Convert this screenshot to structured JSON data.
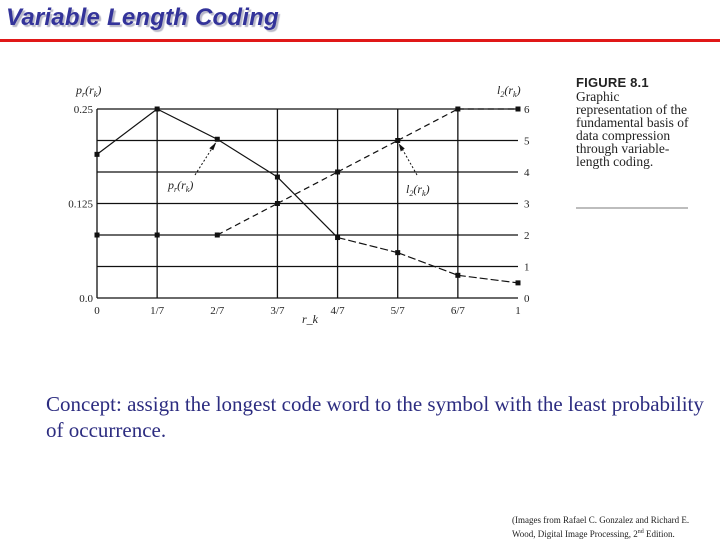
{
  "slide": {
    "title": "Variable Length Coding",
    "accent_color": "#e01818",
    "title_color": "#33339a",
    "concept_text": "Concept: assign the longest code word to the symbol with the least probability of occurrence.",
    "credit_line1": "(Images from Rafael C. Gonzalez and Richard E.",
    "credit_line2_pre": "Wood, Digital Image Processing, 2",
    "credit_sup": "nd",
    "credit_line2_post": " Edition."
  },
  "figure": {
    "label": "FIGURE 8.1",
    "caption": "Graphic representation of the fundamental basis of data compression through variable-length coding."
  },
  "chart_data": {
    "type": "line",
    "title": "",
    "xlabel": "r_k",
    "x": [
      0,
      0.142857,
      0.285714,
      0.428571,
      0.571429,
      0.714286,
      0.857143,
      1
    ],
    "x_tick_labels": [
      "0",
      "1/7",
      "2/7",
      "3/7",
      "4/7",
      "5/7",
      "6/7",
      "1"
    ],
    "left_axis": {
      "label": "p_r(r_k)",
      "ylim": [
        0,
        0.25
      ],
      "tick_values": [
        0,
        0.125,
        0.25
      ],
      "tick_labels": [
        "0.0",
        "0.125",
        "0.25"
      ]
    },
    "right_axis": {
      "label": "l_2(r_k)",
      "ylim": [
        0,
        6
      ],
      "tick_values": [
        0,
        1,
        2,
        3,
        4,
        5,
        6
      ],
      "tick_labels": [
        "0",
        "1",
        "2",
        "3",
        "4",
        "5",
        "6"
      ]
    },
    "grid": true,
    "vertical_gridlines_at": [
      0,
      1,
      3,
      4,
      5,
      6
    ],
    "series": [
      {
        "name": "p_r(r_k)",
        "axis": "left",
        "style": "solid",
        "values": [
          0.19,
          0.25,
          0.21,
          0.16,
          0.08,
          0.06,
          0.03,
          0.02
        ],
        "annotation": {
          "text": "p_r(r_k)",
          "points_to_index": 2
        }
      },
      {
        "name": "l_2(r_k)",
        "axis": "right",
        "style": "dashed",
        "values": [
          2,
          2,
          2,
          3,
          4,
          5,
          6,
          6
        ],
        "annotation": {
          "text": "l_2(r_k)",
          "points_to_index": 5
        }
      }
    ]
  }
}
